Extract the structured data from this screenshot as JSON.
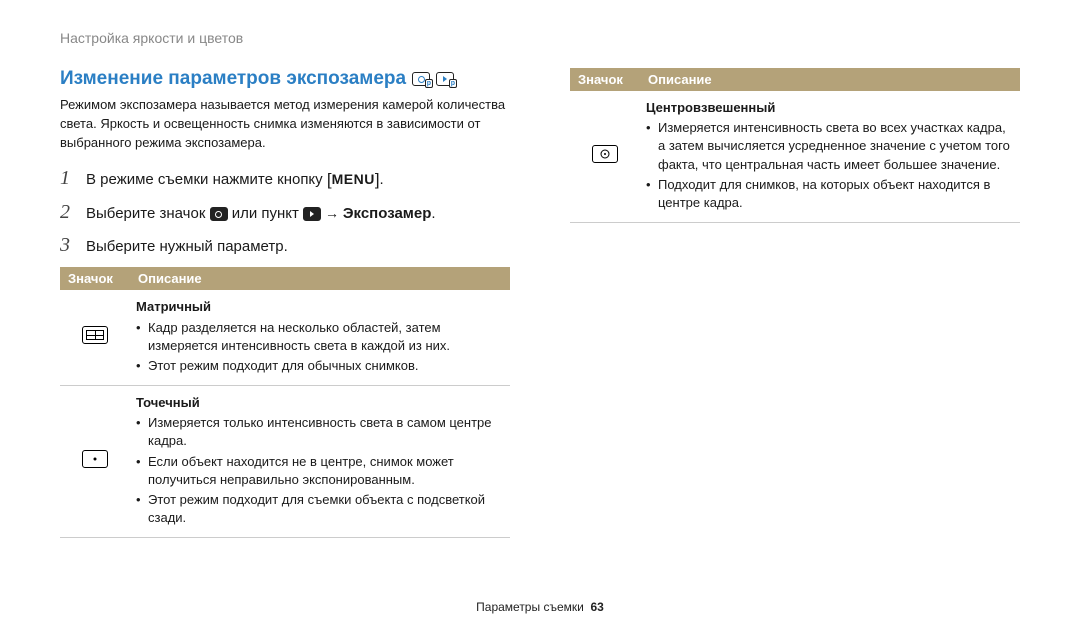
{
  "breadcrumb": "Настройка яркости и цветов",
  "section_title": "Изменение параметров экспозамера",
  "intro": "Режимом экспозамера называется метод измерения камерой количества света. Яркость и освещенность снимка изменяются в зависимости от выбранного режима экспозамера.",
  "steps": {
    "s1": {
      "num": "1",
      "prefix": "В режиме съемки нажмите кнопку ",
      "menu": "MENU",
      "suffix": "."
    },
    "s2": {
      "num": "2",
      "pre": "Выберите значок ",
      "mid1": " или пункт ",
      "arrow": " → ",
      "end": "Экспозамер",
      "dot": "."
    },
    "s3": {
      "num": "3",
      "text": "Выберите нужный параметр."
    }
  },
  "headers": {
    "icon": "Значок",
    "desc": "Описание"
  },
  "rows": {
    "matrix": {
      "title": "Матричный",
      "b1": "Кадр разделяется на несколько областей, затем измеряется интенсивность света в каждой из них.",
      "b2": "Этот режим подходит для обычных снимков."
    },
    "spot": {
      "title": "Точечный",
      "b1": "Измеряется только интенсивность света в самом центре кадра.",
      "b2": "Если объект находится не в центре, снимок может получиться неправильно экспонированным.",
      "b3": "Этот режим подходит для съемки объекта с подсветкой сзади."
    },
    "center": {
      "title": "Центровзвешенный",
      "b1": "Измеряется интенсивность света во всех участках кадра, а затем вычисляется усредненное значение с учетом того факта, что центральная часть имеет большее значение.",
      "b2": "Подходит для снимков, на которых объект находится в центре кадра."
    }
  },
  "footer": {
    "label": "Параметры съемки",
    "page": "63"
  }
}
